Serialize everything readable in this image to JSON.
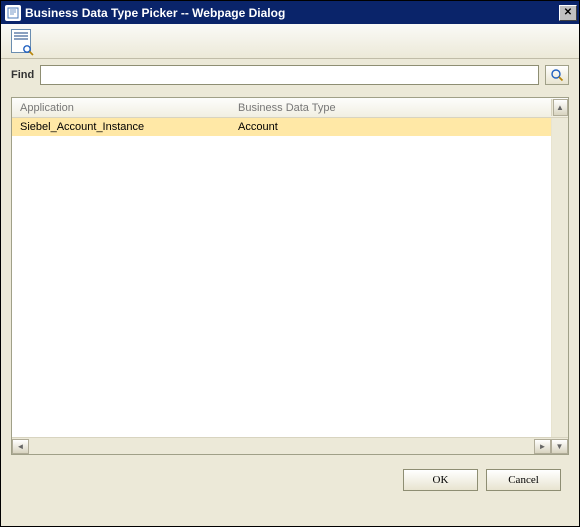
{
  "window": {
    "title": "Business Data Type Picker -- Webpage Dialog"
  },
  "find": {
    "label": "Find",
    "value": ""
  },
  "table": {
    "columns": {
      "application": "Application",
      "bdt": "Business Data Type"
    },
    "rows": [
      {
        "application": "Siebel_Account_Instance",
        "bdt": "Account"
      }
    ]
  },
  "buttons": {
    "ok": "OK",
    "cancel": "Cancel"
  }
}
